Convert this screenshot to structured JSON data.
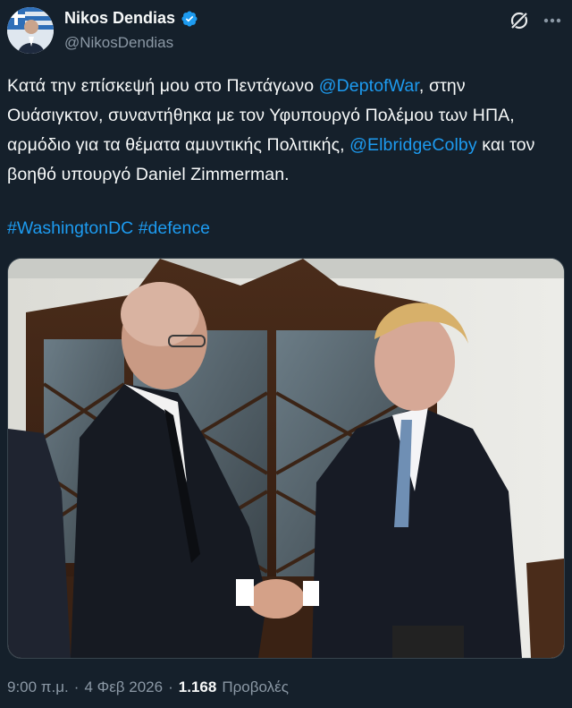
{
  "author": {
    "display_name": "Nikos Dendias",
    "handle": "@NikosDendias",
    "verified": true,
    "avatar_icon": "profile-photo-greek-flag"
  },
  "actions": {
    "grok_icon": "grok-icon",
    "more_icon": "more-horizontal-icon"
  },
  "tweet": {
    "seg1": "Κατά την επίσκεψή μου στο Πεντάγωνο ",
    "mention1": "@DeptofWar",
    "seg2": ", στην Ουάσιγκτον, συναντήθηκα με τον Υφυπουργό Πολέμου των ΗΠΑ, αρμόδιο για τα θέματα αμυντικής Πολιτικής, ",
    "mention2": "@ElbridgeColby",
    "seg3": " και τον βοηθό υπουργό Daniel Zimmerman.",
    "hashtag1": "#WashingtonDC",
    "hashtag2": "#defence"
  },
  "meta": {
    "time": "9:00 π.μ.",
    "sep1": "·",
    "date": "4 Φεβ 2026",
    "sep2": "·",
    "views_count": "1.168",
    "views_label": "Προβολές"
  },
  "colors": {
    "background": "#15202b",
    "link": "#1d9bf0",
    "secondary_text": "#8b98a5",
    "verified": "#1d9bf0"
  }
}
